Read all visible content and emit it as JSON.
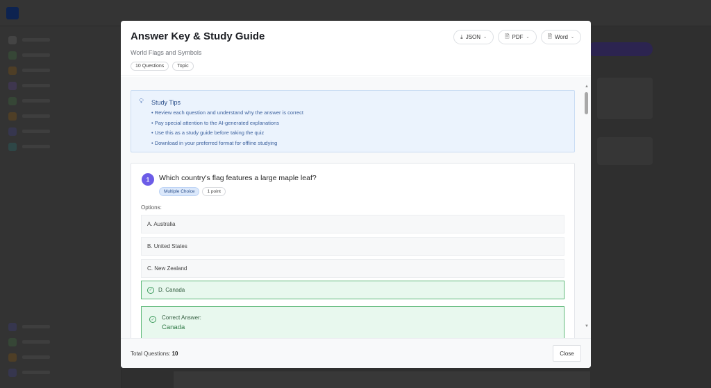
{
  "modal": {
    "title": "Answer Key & Study Guide",
    "subtitle": "World Flags and Symbols",
    "tags": [
      "10 Questions",
      "Topic"
    ],
    "exports": [
      {
        "label": "JSON",
        "icon": "download-icon"
      },
      {
        "label": "PDF",
        "icon": "pdf-file-icon"
      },
      {
        "label": "Word",
        "icon": "word-file-icon"
      }
    ],
    "tips": {
      "heading": "Study Tips",
      "items": [
        "• Review each question and understand why the answer is correct",
        "• Pay special attention to the AI-generated explanations",
        "• Use this as a study guide before taking the quiz",
        "• Download in your preferred format for offline studying"
      ]
    },
    "question": {
      "number": "1",
      "text": "Which country's flag features a large maple leaf?",
      "type": "Multiple Choice",
      "points": "1 point",
      "options_label": "Options:",
      "options": [
        "A. Australia",
        "B. United States",
        "C. New Zealand",
        "D. Canada"
      ],
      "correct_label": "Correct Answer:",
      "correct_value": "Canada"
    },
    "footer": {
      "total_label": "Total Questions:",
      "total_value": "10",
      "close_label": "Close"
    }
  },
  "colors": {
    "accent": "#6c5ce7",
    "correct": "#5cb878",
    "tips_bg": "#ebf3fd"
  }
}
